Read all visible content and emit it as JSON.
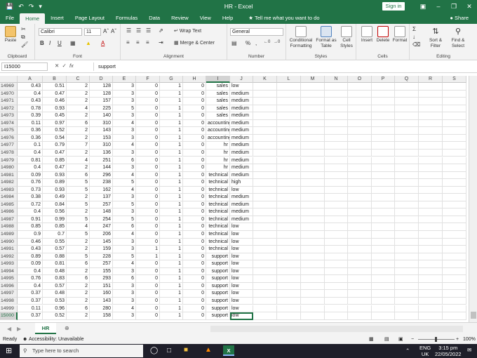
{
  "window": {
    "title": "HR  -  Excel",
    "sign_in": "Sign in"
  },
  "tabs": [
    "File",
    "Home",
    "Insert",
    "Page Layout",
    "Formulas",
    "Data",
    "Review",
    "View",
    "Help"
  ],
  "active_tab": "Home",
  "tell_me": "Tell me what you want to do",
  "share": "Share",
  "ribbon": {
    "paste": "Paste",
    "font_name": "Calibri",
    "font_size": "11",
    "wrap_text": "Wrap Text",
    "merge_center": "Merge & Center",
    "number_format": "General",
    "conditional_formatting": "Conditional Formatting",
    "format_as_table": "Format as Table",
    "cell_styles": "Cell Styles",
    "insert": "Insert",
    "delete": "Delete",
    "format": "Format",
    "sort_filter": "Sort & Filter",
    "find_select": "Find & Select",
    "groups": [
      "Clipboard",
      "Font",
      "Alignment",
      "Number",
      "Styles",
      "Cells",
      "Editing"
    ]
  },
  "formula_bar": {
    "name_box": "I15000",
    "value": "support",
    "fx": "fx"
  },
  "columns": [
    "A",
    "B",
    "C",
    "D",
    "E",
    "F",
    "G",
    "H",
    "I",
    "J",
    "K",
    "L",
    "M",
    "N",
    "O",
    "P",
    "Q",
    "R",
    "S"
  ],
  "rows": [
    [
      14969,
      "0.43",
      "0.51",
      "2",
      "128",
      "3",
      "0",
      "1",
      "0",
      "sales",
      "low"
    ],
    [
      14970,
      "0.4",
      "0.47",
      "2",
      "128",
      "3",
      "0",
      "1",
      "0",
      "sales",
      "medium"
    ],
    [
      14971,
      "0.43",
      "0.46",
      "2",
      "157",
      "3",
      "0",
      "1",
      "0",
      "sales",
      "medium"
    ],
    [
      14972,
      "0.78",
      "0.93",
      "4",
      "225",
      "5",
      "0",
      "1",
      "0",
      "sales",
      "medium"
    ],
    [
      14973,
      "0.39",
      "0.45",
      "2",
      "140",
      "3",
      "0",
      "1",
      "0",
      "sales",
      "medium"
    ],
    [
      14974,
      "0.11",
      "0.97",
      "6",
      "310",
      "4",
      "0",
      "1",
      "0",
      "accounting",
      "medium"
    ],
    [
      14975,
      "0.36",
      "0.52",
      "2",
      "143",
      "3",
      "0",
      "1",
      "0",
      "accounting",
      "medium"
    ],
    [
      14976,
      "0.36",
      "0.54",
      "2",
      "153",
      "3",
      "0",
      "1",
      "0",
      "accounting",
      "medium"
    ],
    [
      14977,
      "0.1",
      "0.79",
      "7",
      "310",
      "4",
      "0",
      "1",
      "0",
      "hr",
      "medium"
    ],
    [
      14978,
      "0.4",
      "0.47",
      "2",
      "136",
      "3",
      "0",
      "1",
      "0",
      "hr",
      "medium"
    ],
    [
      14979,
      "0.81",
      "0.85",
      "4",
      "251",
      "6",
      "0",
      "1",
      "0",
      "hr",
      "medium"
    ],
    [
      14980,
      "0.4",
      "0.47",
      "2",
      "144",
      "3",
      "0",
      "1",
      "0",
      "hr",
      "medium"
    ],
    [
      14981,
      "0.09",
      "0.93",
      "6",
      "296",
      "4",
      "0",
      "1",
      "0",
      "technical",
      "medium"
    ],
    [
      14982,
      "0.76",
      "0.89",
      "5",
      "238",
      "5",
      "0",
      "1",
      "0",
      "technical",
      "high"
    ],
    [
      14983,
      "0.73",
      "0.93",
      "5",
      "162",
      "4",
      "0",
      "1",
      "0",
      "technical",
      "low"
    ],
    [
      14984,
      "0.38",
      "0.49",
      "2",
      "137",
      "3",
      "0",
      "1",
      "0",
      "technical",
      "medium"
    ],
    [
      14985,
      "0.72",
      "0.84",
      "5",
      "257",
      "5",
      "0",
      "1",
      "0",
      "technical",
      "medium"
    ],
    [
      14986,
      "0.4",
      "0.56",
      "2",
      "148",
      "3",
      "0",
      "1",
      "0",
      "technical",
      "medium"
    ],
    [
      14987,
      "0.91",
      "0.99",
      "5",
      "254",
      "5",
      "0",
      "1",
      "0",
      "technical",
      "medium"
    ],
    [
      14988,
      "0.85",
      "0.85",
      "4",
      "247",
      "6",
      "0",
      "1",
      "0",
      "technical",
      "low"
    ],
    [
      14989,
      "0.9",
      "0.7",
      "5",
      "206",
      "4",
      "0",
      "1",
      "0",
      "technical",
      "low"
    ],
    [
      14990,
      "0.46",
      "0.55",
      "2",
      "145",
      "3",
      "0",
      "1",
      "0",
      "technical",
      "low"
    ],
    [
      14991,
      "0.43",
      "0.57",
      "2",
      "159",
      "3",
      "1",
      "1",
      "0",
      "technical",
      "low"
    ],
    [
      14992,
      "0.89",
      "0.88",
      "5",
      "228",
      "5",
      "1",
      "1",
      "0",
      "support",
      "low"
    ],
    [
      14993,
      "0.09",
      "0.81",
      "6",
      "257",
      "4",
      "0",
      "1",
      "0",
      "support",
      "low"
    ],
    [
      14994,
      "0.4",
      "0.48",
      "2",
      "155",
      "3",
      "0",
      "1",
      "0",
      "support",
      "low"
    ],
    [
      14995,
      "0.76",
      "0.83",
      "6",
      "293",
      "6",
      "0",
      "1",
      "0",
      "support",
      "low"
    ],
    [
      14996,
      "0.4",
      "0.57",
      "2",
      "151",
      "3",
      "0",
      "1",
      "0",
      "support",
      "low"
    ],
    [
      14997,
      "0.37",
      "0.48",
      "2",
      "160",
      "3",
      "0",
      "1",
      "0",
      "support",
      "low"
    ],
    [
      14998,
      "0.37",
      "0.53",
      "2",
      "143",
      "3",
      "0",
      "1",
      "0",
      "support",
      "low"
    ],
    [
      14999,
      "0.11",
      "0.96",
      "6",
      "280",
      "4",
      "0",
      "1",
      "0",
      "support",
      "low"
    ],
    [
      15000,
      "0.37",
      "0.52",
      "2",
      "158",
      "3",
      "0",
      "1",
      "0",
      "support",
      "low"
    ]
  ],
  "sheet": {
    "name": "HR"
  },
  "status": {
    "ready": "Ready",
    "accessibility": "Accessibility: Unavailable",
    "zoom": "100%"
  },
  "taskbar": {
    "search": "Type here to search",
    "lang": "ENG",
    "region": "UK",
    "time": "3:15 pm",
    "date": "22/05/2022"
  },
  "colors": {
    "excel_green": "#217346",
    "selection": "#217346"
  }
}
